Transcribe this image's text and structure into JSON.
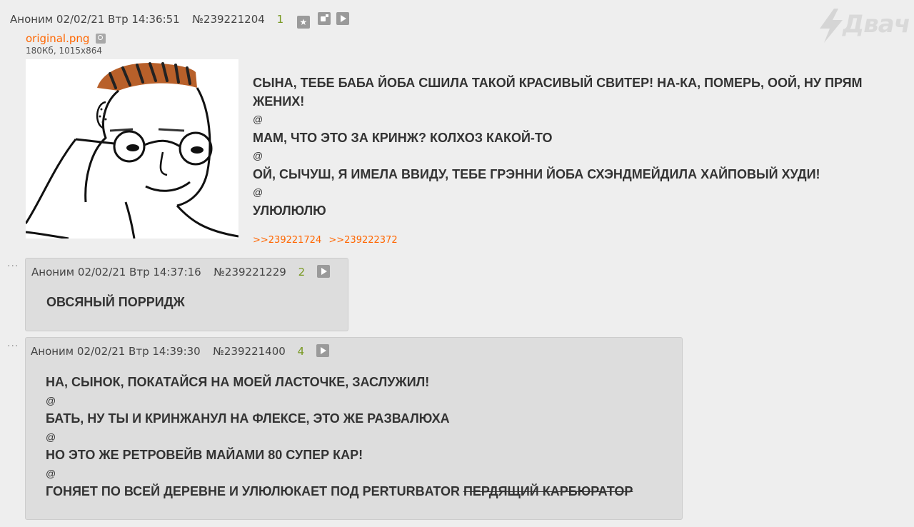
{
  "logo": {
    "text": "Двач"
  },
  "op": {
    "author": "Аноним",
    "date": "02/02/21 Втр 14:36:51",
    "number": "№239221204",
    "index": "1",
    "file": {
      "name": "original.png",
      "info": "180Кб, 1015x864"
    },
    "lines": [
      "СЫНА, ТЕБЕ БАБА ЙОБА СШИЛА ТАКОЙ КРАСИВЫЙ СВИТЕР! НА-КА, ПОМЕРЬ, ООЙ, НУ ПРЯМ",
      "ЖЕНИХ!",
      "@",
      "МАМ, ЧТО ЭТО ЗА КРИНЖ? КОЛХОЗ КАКОЙ-ТО",
      "@",
      "ОЙ, СЫЧУШ, Я ИМЕЛА ВВИДУ, ТЕБЕ ГРЭННИ ЙОБА СХЭНДМЕЙДИЛА ХАЙПОВЫЙ ХУДИ!",
      "@",
      "УЛЮЛЮЛЮ"
    ],
    "replies": [
      ">>239221724",
      ">>239222372"
    ]
  },
  "reply1": {
    "dots": "...",
    "author": "Аноним",
    "date": "02/02/21 Втр 14:37:16",
    "number": "№239221229",
    "index": "2",
    "text": "ОВСЯНЫЙ ПОРРИДЖ"
  },
  "reply2": {
    "dots": "...",
    "author": "Аноним",
    "date": "02/02/21 Втр 14:39:30",
    "number": "№239221400",
    "index": "4",
    "lines": [
      "НА, СЫНОК, ПОКАТАЙСЯ НА МОЕЙ ЛАСТОЧКЕ, ЗАСЛУЖИЛ!",
      "@",
      "БАТЬ, НУ ТЫ И КРИНЖАНУЛ НА ФЛЕКСЕ, ЭТО ЖЕ РАЗВАЛЮХА",
      "@",
      "НО ЭТО ЖЕ РЕТРОВЕЙВ МАЙАМИ 80 СУПЕР КАР!",
      "@"
    ],
    "last_line_plain": "ГОНЯЕТ ПО ВСЕЙ ДЕРЕВНЕ И УЛЮЛЮКАЕТ ПОД PERTURBATOR ",
    "last_line_strike": "ПЕРДЯЩИЙ КАРБЮРАТОР"
  }
}
